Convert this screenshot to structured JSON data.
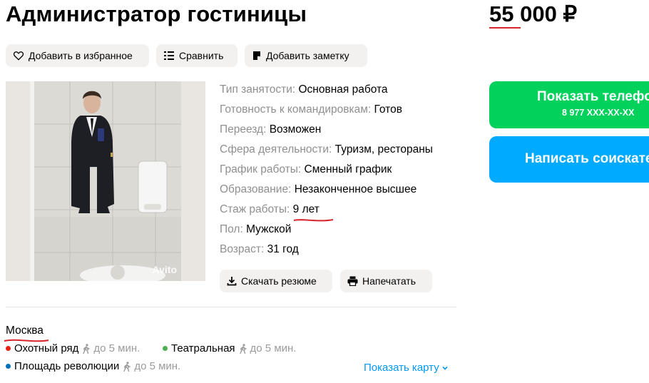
{
  "header": {
    "title": "Администратор гостиницы",
    "price": "55 000 ₽"
  },
  "actions": {
    "favorite": "Добавить в избранное",
    "compare": "Сравнить",
    "note": "Добавить заметку"
  },
  "photo": {
    "watermark": "Avito"
  },
  "params": [
    {
      "label": "Тип занятости:",
      "value": "Основная работа"
    },
    {
      "label": "Готовность к командировкам:",
      "value": "Готов"
    },
    {
      "label": "Переезд:",
      "value": "Возможен"
    },
    {
      "label": "Сфера деятельности:",
      "value": "Туризм, рестораны"
    },
    {
      "label": "График работы:",
      "value": "Сменный график"
    },
    {
      "label": "Образование:",
      "value": "Незаконченное высшее"
    },
    {
      "label": "Стаж работы:",
      "value": "9 лет"
    },
    {
      "label": "Пол:",
      "value": "Мужской"
    },
    {
      "label": "Возраст:",
      "value": "31 год"
    }
  ],
  "resume_actions": {
    "download": "Скачать резюме",
    "print": "Напечатать"
  },
  "location": {
    "city": "Москва",
    "metro": [
      {
        "name": "Охотный ряд",
        "time": "до 5 мин.",
        "color": "#e42313"
      },
      {
        "name": "Театральная",
        "time": "до 5 мин.",
        "color": "#4caf50"
      },
      {
        "name": "Площадь революции",
        "time": "до 5 мин.",
        "color": "#0072ba"
      }
    ],
    "show_map": "Показать карту"
  },
  "contact": {
    "call_label": "Показать телефон",
    "phone": "8 977 XXX-XX-XX",
    "write_label": "Написать соискателю"
  }
}
